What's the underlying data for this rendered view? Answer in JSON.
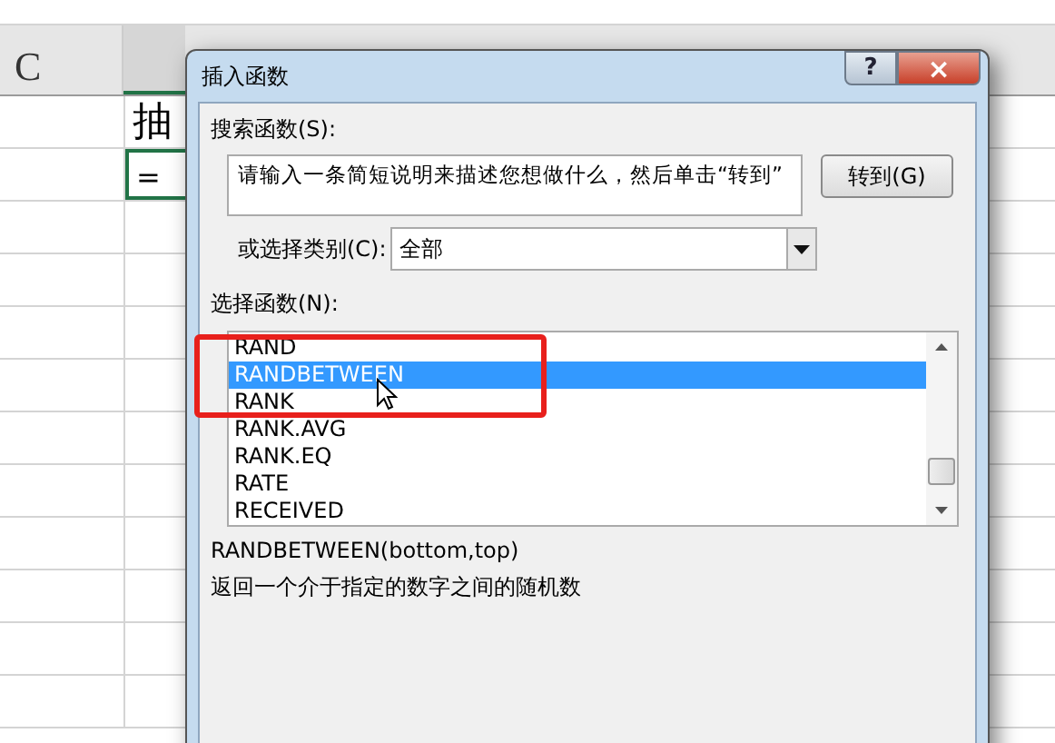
{
  "sheet": {
    "column_header": "C",
    "cells": [
      {
        "text": "抽",
        "selected": false
      },
      {
        "text": "=",
        "selected": true
      }
    ]
  },
  "dialog": {
    "title": "插入函数",
    "help_button": "?",
    "close_button": "×",
    "search": {
      "label": "搜索函数(S):",
      "placeholder": "请输入一条简短说明来描述您想做什么，然后单击“转到”",
      "go_button": "转到(G)"
    },
    "category": {
      "label": "或选择类别(C):",
      "value": "全部"
    },
    "functions": {
      "label": "选择函数(N):",
      "items": [
        {
          "name": "RAND",
          "selected": false
        },
        {
          "name": "RANDBETWEEN",
          "selected": true
        },
        {
          "name": "RANK",
          "selected": false
        },
        {
          "name": "RANK.AVG",
          "selected": false
        },
        {
          "name": "RANK.EQ",
          "selected": false
        },
        {
          "name": "RATE",
          "selected": false
        },
        {
          "name": "RECEIVED",
          "selected": false
        }
      ]
    },
    "signature": "RANDBETWEEN(bottom,top)",
    "description": "返回一个介于指定的数字之间的随机数"
  }
}
